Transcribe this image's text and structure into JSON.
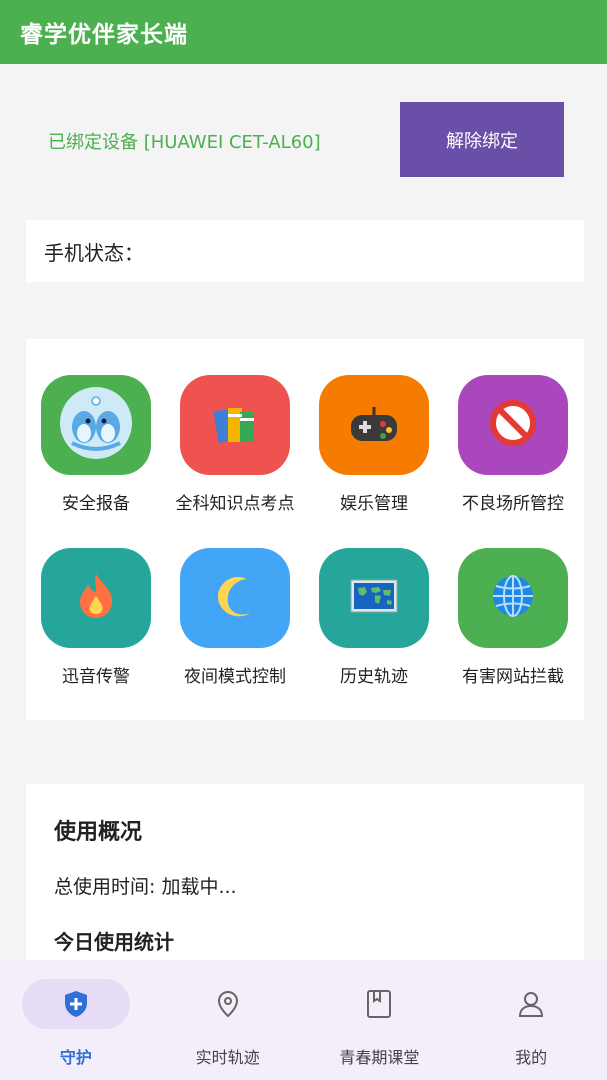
{
  "header": {
    "title": "睿学优伴家长端"
  },
  "device": {
    "bound_text": "已绑定设备 [HUAWEI CET-AL60]",
    "unbind_label": "解除绑定"
  },
  "phone_status": {
    "label": "手机状态："
  },
  "features": [
    {
      "label": "安全报备",
      "icon": "dolphins-icon",
      "color": "#4caf50"
    },
    {
      "label": "全科知识点考点",
      "icon": "books-icon",
      "color": "#ef5350"
    },
    {
      "label": "娱乐管理",
      "icon": "gamepad-icon",
      "color": "#f57c00"
    },
    {
      "label": "不良场所管控",
      "icon": "prohibited-icon",
      "color": "#ab47bc"
    },
    {
      "label": "迅音传警",
      "icon": "fire-icon",
      "color": "#26a69a"
    },
    {
      "label": "夜间模式控制",
      "icon": "moon-icon",
      "color": "#42a5f5"
    },
    {
      "label": "历史轨迹",
      "icon": "world-map-icon",
      "color": "#26a69a"
    },
    {
      "label": "有害网站拦截",
      "icon": "globe-icon",
      "color": "#4caf50"
    }
  ],
  "usage": {
    "title": "使用概况",
    "total_time": "总使用时间: 加载中...",
    "today_title": "今日使用统计"
  },
  "nav": [
    {
      "label": "守护",
      "icon": "shield-plus-icon",
      "active": true
    },
    {
      "label": "实时轨迹",
      "icon": "location-pin-icon",
      "active": false
    },
    {
      "label": "青春期课堂",
      "icon": "book-icon",
      "active": false
    },
    {
      "label": "我的",
      "icon": "person-icon",
      "active": false
    }
  ],
  "colors": {
    "header": "#4caf50",
    "unbind_button": "#6a4fa8",
    "nav_active": "#2f6fd6",
    "nav_background": "#f4eefa"
  }
}
